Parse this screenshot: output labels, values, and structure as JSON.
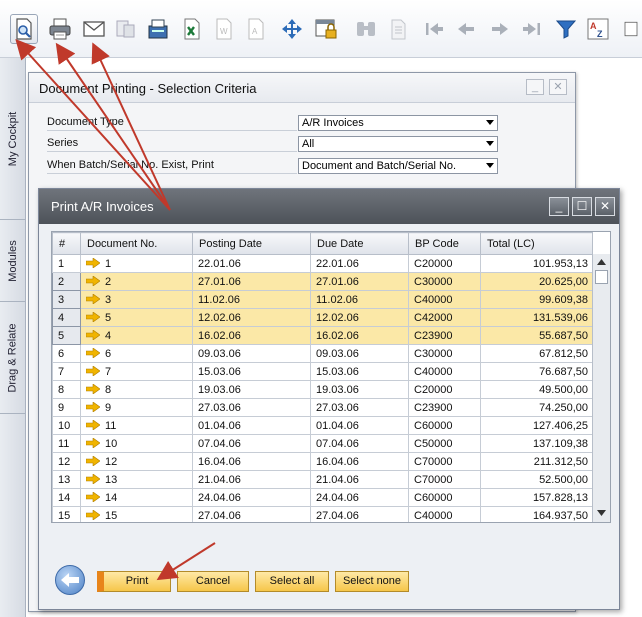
{
  "toolbar": {
    "items": [
      {
        "icon": "print-preview-icon",
        "active": true
      },
      {
        "icon": "printer-icon"
      },
      {
        "icon": "email-icon"
      },
      {
        "icon": "send-message-icon"
      },
      {
        "icon": "fax-icon"
      },
      {
        "icon": "export-excel-icon"
      },
      {
        "icon": "export-word-icon"
      },
      {
        "icon": "export-pdf-icon"
      },
      {
        "icon": "move-icon"
      },
      {
        "icon": "lock-icon"
      },
      {
        "icon": "find-icon"
      },
      {
        "icon": "add-icon"
      },
      {
        "icon": "first-record-icon"
      },
      {
        "icon": "previous-record-icon"
      },
      {
        "icon": "next-record-icon"
      },
      {
        "icon": "last-record-icon"
      },
      {
        "icon": "filter-icon"
      },
      {
        "icon": "sort-az-icon"
      }
    ]
  },
  "side_tabs": [
    "My Cockpit",
    "Modules",
    "Drag & Relate"
  ],
  "criteria_window": {
    "title": "Document Printing - Selection Criteria",
    "fields": [
      {
        "label": "Document Type",
        "value": "A/R Invoices"
      },
      {
        "label": "Series",
        "value": "All"
      },
      {
        "label": "When Batch/Serial No. Exist, Print",
        "value": "Document and Batch/Serial No."
      }
    ]
  },
  "dialog": {
    "title": "Print A/R Invoices",
    "columns": [
      "#",
      "Document No.",
      "Posting Date",
      "Due Date",
      "BP Code",
      "Total (LC)"
    ],
    "rows": [
      {
        "n": "1",
        "doc": "1",
        "post": "22.01.06",
        "due": "22.01.06",
        "bp": "C20000",
        "total": "101.953,13",
        "selected": false
      },
      {
        "n": "2",
        "doc": "2",
        "post": "27.01.06",
        "due": "27.01.06",
        "bp": "C30000",
        "total": "20.625,00",
        "selected": true
      },
      {
        "n": "3",
        "doc": "3",
        "post": "11.02.06",
        "due": "11.02.06",
        "bp": "C40000",
        "total": "99.609,38",
        "selected": true
      },
      {
        "n": "4",
        "doc": "5",
        "post": "12.02.06",
        "due": "12.02.06",
        "bp": "C42000",
        "total": "131.539,06",
        "selected": true
      },
      {
        "n": "5",
        "doc": "4",
        "post": "16.02.06",
        "due": "16.02.06",
        "bp": "C23900",
        "total": "55.687,50",
        "selected": true
      },
      {
        "n": "6",
        "doc": "6",
        "post": "09.03.06",
        "due": "09.03.06",
        "bp": "C30000",
        "total": "67.812,50",
        "selected": false
      },
      {
        "n": "7",
        "doc": "7",
        "post": "15.03.06",
        "due": "15.03.06",
        "bp": "C40000",
        "total": "76.687,50",
        "selected": false
      },
      {
        "n": "8",
        "doc": "8",
        "post": "19.03.06",
        "due": "19.03.06",
        "bp": "C20000",
        "total": "49.500,00",
        "selected": false
      },
      {
        "n": "9",
        "doc": "9",
        "post": "27.03.06",
        "due": "27.03.06",
        "bp": "C23900",
        "total": "74.250,00",
        "selected": false
      },
      {
        "n": "10",
        "doc": "11",
        "post": "01.04.06",
        "due": "01.04.06",
        "bp": "C60000",
        "total": "127.406,25",
        "selected": false
      },
      {
        "n": "11",
        "doc": "10",
        "post": "07.04.06",
        "due": "07.04.06",
        "bp": "C50000",
        "total": "137.109,38",
        "selected": false
      },
      {
        "n": "12",
        "doc": "12",
        "post": "16.04.06",
        "due": "16.04.06",
        "bp": "C70000",
        "total": "211.312,50",
        "selected": false
      },
      {
        "n": "13",
        "doc": "13",
        "post": "21.04.06",
        "due": "21.04.06",
        "bp": "C70000",
        "total": "52.500,00",
        "selected": false
      },
      {
        "n": "14",
        "doc": "14",
        "post": "24.04.06",
        "due": "24.04.06",
        "bp": "C60000",
        "total": "157.828,13",
        "selected": false
      },
      {
        "n": "15",
        "doc": "15",
        "post": "27.04.06",
        "due": "27.04.06",
        "bp": "C40000",
        "total": "164.937,50",
        "selected": false
      }
    ],
    "buttons": {
      "print": "Print",
      "cancel": "Cancel",
      "select_all": "Select all",
      "select_none": "Select none"
    }
  },
  "colors": {
    "selected_row": "#fbe8a7",
    "button_fill": "#f6c64a",
    "annotation_arrow": "#c0392b",
    "link_arrow": "#f0b400"
  }
}
